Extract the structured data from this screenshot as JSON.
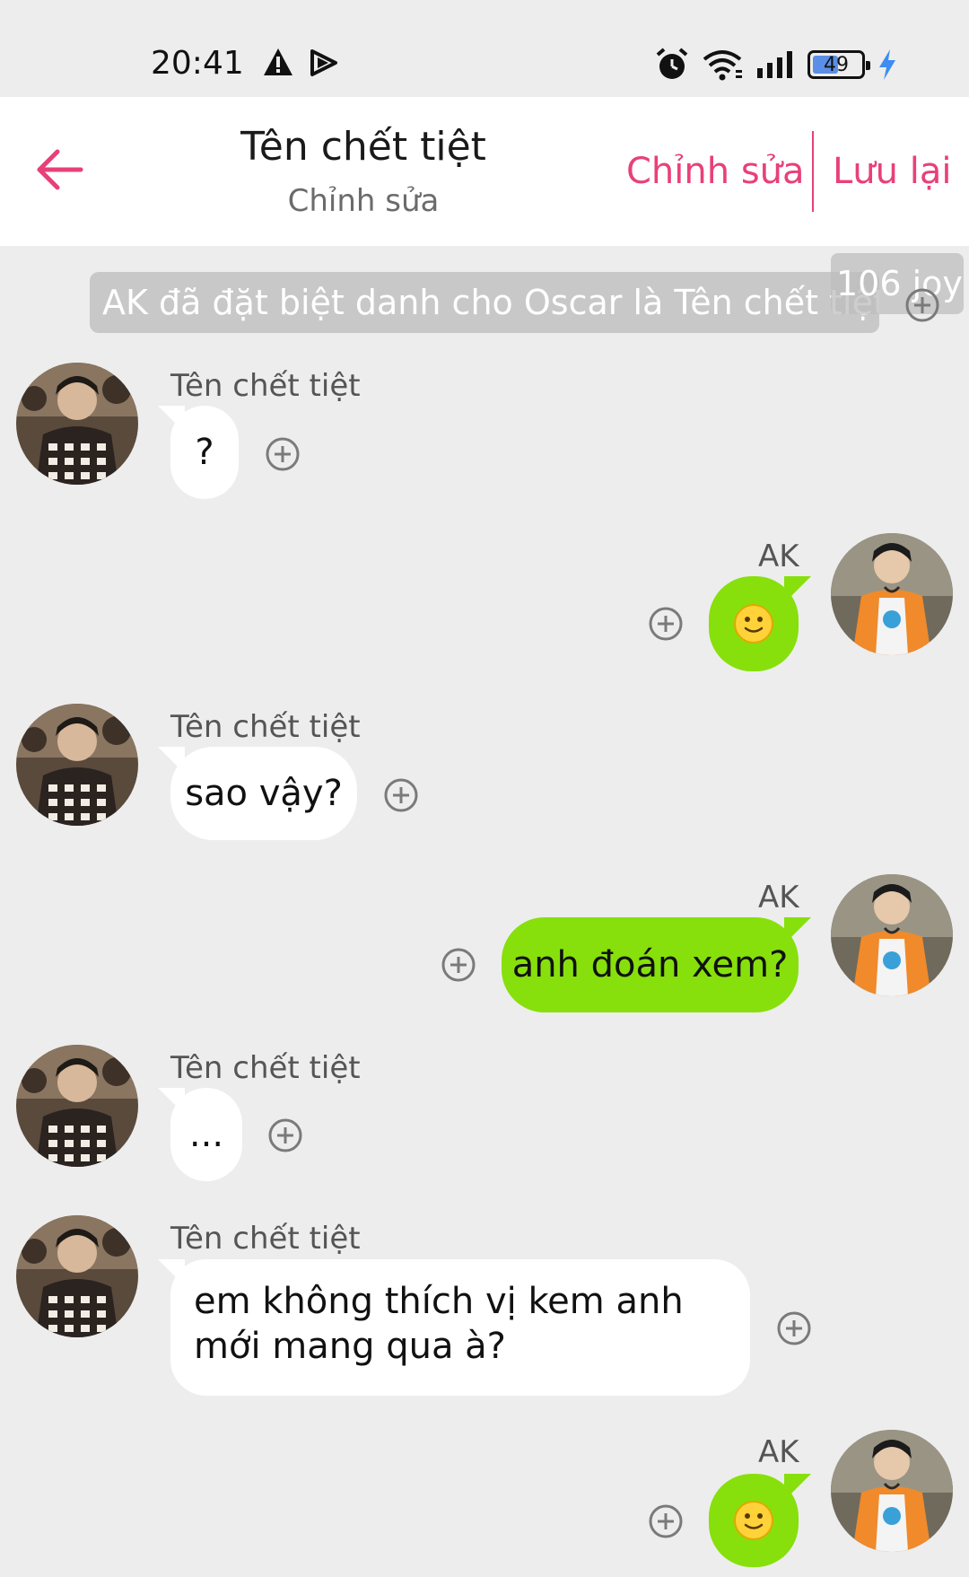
{
  "status_bar": {
    "time": "20:41",
    "battery": "49",
    "icons": [
      "warning-icon",
      "play-store-icon",
      "alarm-icon",
      "wifi-icon",
      "signal-icon",
      "battery-icon",
      "charging-icon"
    ]
  },
  "header": {
    "title": "Tên chết tiệt",
    "subtitle": "Chỉnh sửa",
    "edit_label": "Chỉnh sửa",
    "save_label": "Lưu lại",
    "accent_color": "#e8407a"
  },
  "notice": {
    "text": "AK đã đặt biệt danh cho Oscar là Tên chết tiệt",
    "joy_tag": "106 joy"
  },
  "colors": {
    "background": "#ededed",
    "left_bubble": "#ffffff",
    "right_bubble": "#87e00b"
  },
  "messages": [
    {
      "side": "left",
      "sender": "Tên chết tiệt",
      "text": "?"
    },
    {
      "side": "right",
      "sender": "AK",
      "text": "🙂"
    },
    {
      "side": "left",
      "sender": "Tên chết tiệt",
      "text": "sao vậy?"
    },
    {
      "side": "right",
      "sender": "AK",
      "text": "anh đoán xem?"
    },
    {
      "side": "left",
      "sender": "Tên chết tiệt",
      "text": "..."
    },
    {
      "side": "left",
      "sender": "Tên chết tiệt",
      "text": "em không thích vị kem anh mới mang qua à?"
    },
    {
      "side": "right",
      "sender": "AK",
      "text": "🙂"
    }
  ]
}
